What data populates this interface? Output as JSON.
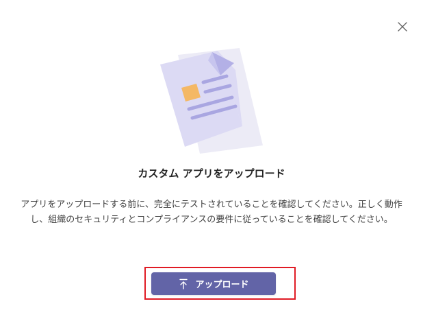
{
  "dialog": {
    "title": "カスタム アプリをアップロード",
    "description": "アプリをアップロードする前に、完全にテストされていることを確認してください。正しく動作し、組織のセキュリティとコンプライアンスの要件に従っていることを確認してください。",
    "upload_button_label": "アップロード",
    "close_icon": "close-icon",
    "upload_icon": "upload-arrow-icon",
    "illustration": "document-illustration"
  },
  "colors": {
    "accent": "#6264a7",
    "highlight": "#e01b24",
    "title_text": "#242424",
    "body_text": "#424242"
  }
}
